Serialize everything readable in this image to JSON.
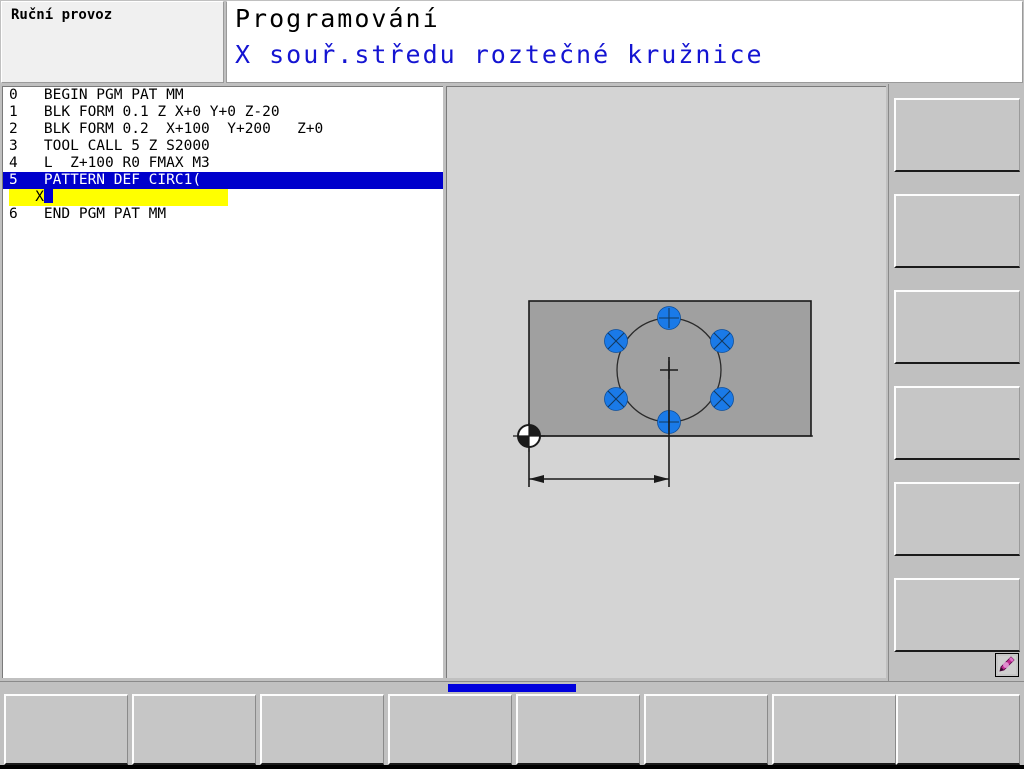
{
  "header": {
    "mode_label": "Ruční provoz",
    "title": "Programování",
    "subtitle": "X souř.středu roztečné kružnice",
    "title_color": "#000000",
    "subtitle_color": "#1414d2"
  },
  "program": {
    "lines": [
      {
        "num": "0",
        "text": "BEGIN PGM PAT MM",
        "selected": false
      },
      {
        "num": "1",
        "text": "BLK FORM 0.1 Z X+0 Y+0 Z-20",
        "selected": false
      },
      {
        "num": "2",
        "text": "BLK FORM 0.2  X+100  Y+200   Z+0",
        "selected": false
      },
      {
        "num": "3",
        "text": "TOOL CALL 5 Z S2000",
        "selected": false
      },
      {
        "num": "4",
        "text": "L  Z+100 R0 FMAX M3",
        "selected": false
      },
      {
        "num": "5",
        "text": "PATTERN DEF CIRC1(",
        "selected": true
      },
      {
        "num": "6",
        "text": "END PGM PAT MM",
        "selected": false
      }
    ],
    "input_row": {
      "label": "X",
      "value": "",
      "field_color": "#ffff00",
      "cursor_color": "#0000cc"
    },
    "selection_color": "#0000cc"
  },
  "graphics": {
    "description": "bolt-hole-circle-pattern",
    "workpiece_fill": "#a0a0a0",
    "hole_fill": "#1a7ae8",
    "hole_count": 6,
    "datum_symbol": "workpiece-datum-origin",
    "dimension": "X center distance",
    "background": "#d4d4d4"
  },
  "right_soft_keys": [
    {
      "label": ""
    },
    {
      "label": ""
    },
    {
      "label": ""
    },
    {
      "label": ""
    },
    {
      "label": ""
    },
    {
      "label": ""
    }
  ],
  "bottom_soft_keys": [
    {
      "label": ""
    },
    {
      "label": ""
    },
    {
      "label": ""
    },
    {
      "label": ""
    },
    {
      "label": ""
    },
    {
      "label": ""
    },
    {
      "label": ""
    },
    {
      "label": ""
    }
  ],
  "status_icon": {
    "name": "edit-pencil-icon",
    "color": "#b02090"
  },
  "softkey_indicator": {
    "color": "#0000dd"
  }
}
